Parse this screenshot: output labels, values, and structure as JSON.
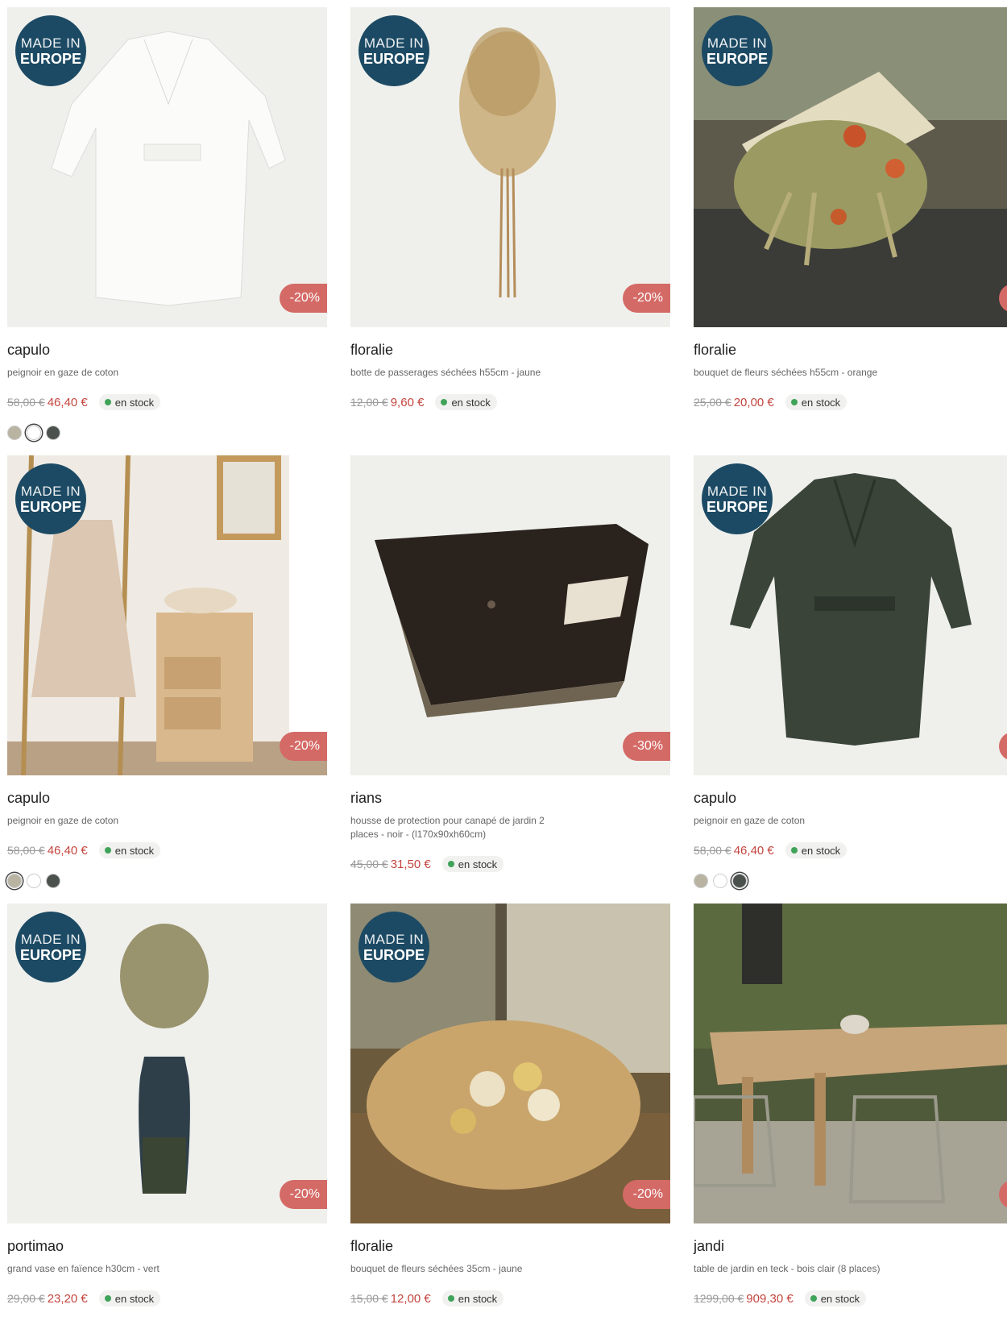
{
  "badges": {
    "europe_line1": "MADE IN",
    "europe_line2": "EUROPE"
  },
  "products": [
    {
      "name": "capulo",
      "desc": "peignoir en gaze de coton",
      "old_price": "58,00 €",
      "new_price": "46,40 €",
      "stock": "en stock",
      "discount": "-20%",
      "made_in_europe": true,
      "swatches": [
        "#b9b3a2",
        "#ffffff",
        "#4b524e"
      ],
      "selected_swatch": 1,
      "image": "white-bathrobe"
    },
    {
      "name": "floralie",
      "desc": "botte de passerages séchées h55cm - jaune",
      "old_price": "12,00 €",
      "new_price": "9,60 €",
      "stock": "en stock",
      "discount": "-20%",
      "made_in_europe": true,
      "swatches": [],
      "image": "dried-grass-bunch"
    },
    {
      "name": "floralie",
      "desc": "bouquet de fleurs séchées h55cm - orange",
      "old_price": "25,00 €",
      "new_price": "20,00 €",
      "stock": "en stock",
      "discount": "",
      "made_in_europe": true,
      "swatches": [],
      "image": "dried-flower-bouquet-orange"
    },
    {
      "name": "capulo",
      "desc": "peignoir en gaze de coton",
      "old_price": "58,00 €",
      "new_price": "46,40 €",
      "stock": "en stock",
      "discount": "-20%",
      "made_in_europe": true,
      "swatches": [
        "#b9b3a2",
        "#ffffff",
        "#4b524e"
      ],
      "selected_swatch": 0,
      "image": "bathroom-bathrobe"
    },
    {
      "name": "rians",
      "desc": "housse de protection pour canapé de jardin 2 places - noir - (l170x90xh60cm)",
      "old_price": "45,00 €",
      "new_price": "31,50 €",
      "stock": "en stock",
      "discount": "-30%",
      "made_in_europe": false,
      "swatches": [],
      "image": "sofa-cover"
    },
    {
      "name": "capulo",
      "desc": "peignoir en gaze de coton",
      "old_price": "58,00 €",
      "new_price": "46,40 €",
      "stock": "en stock",
      "discount": "",
      "made_in_europe": true,
      "swatches": [
        "#b9b3a2",
        "#ffffff",
        "#4b524e"
      ],
      "selected_swatch": 2,
      "image": "green-bathrobe"
    },
    {
      "name": "portimao",
      "desc": "grand vase en faïence h30cm - vert",
      "old_price": "29,00 €",
      "new_price": "23,20 €",
      "stock": "en stock",
      "discount": "-20%",
      "made_in_europe": true,
      "swatches": [],
      "image": "green-vase"
    },
    {
      "name": "floralie",
      "desc": "bouquet de fleurs séchées 35cm - jaune",
      "old_price": "15,00 €",
      "new_price": "12,00 €",
      "stock": "en stock",
      "discount": "-20%",
      "made_in_europe": true,
      "swatches": [],
      "image": "dried-flower-bouquet-yellow"
    },
    {
      "name": "jandi",
      "desc": "table de jardin en teck - bois clair (8 places)",
      "old_price": "1299,00 €",
      "new_price": "909,30 €",
      "stock": "en stock",
      "discount": "",
      "made_in_europe": false,
      "swatches": [],
      "image": "teak-garden-table"
    }
  ],
  "colors": {
    "discount_bg": "#d46a66",
    "europe_badge_bg": "#1c4a64",
    "price_red": "#c4453f",
    "stock_green": "#3fa35a"
  }
}
